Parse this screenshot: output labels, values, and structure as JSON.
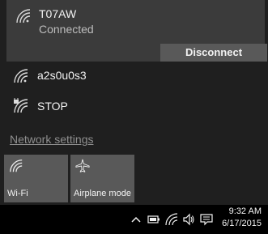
{
  "networks": {
    "connected": {
      "name": "T07AW",
      "status": "Connected",
      "disconnect_label": "Disconnect",
      "icon": "wifi-icon"
    },
    "list": [
      {
        "name": "a2s0u0s3",
        "icon": "wifi-icon"
      },
      {
        "name": "STOP",
        "icon": "wifi-secured-icon"
      }
    ]
  },
  "network_settings_label": "Network settings",
  "quick_actions": [
    {
      "label": "Wi-Fi",
      "icon": "wifi-icon"
    },
    {
      "label": "Airplane mode",
      "icon": "airplane-icon"
    }
  ],
  "taskbar": {
    "icons": [
      "chevron-up-icon",
      "battery-icon",
      "wifi-icon",
      "volume-icon",
      "action-center-icon"
    ],
    "time": "9:32 AM",
    "date": "6/17/2015"
  },
  "colors": {
    "flyout_bg": "#1f1f1f",
    "selected_bg": "#3b3b3b",
    "tile_bg": "#595959",
    "taskbar_bg": "#000000",
    "link_color": "#8f8f8f"
  }
}
